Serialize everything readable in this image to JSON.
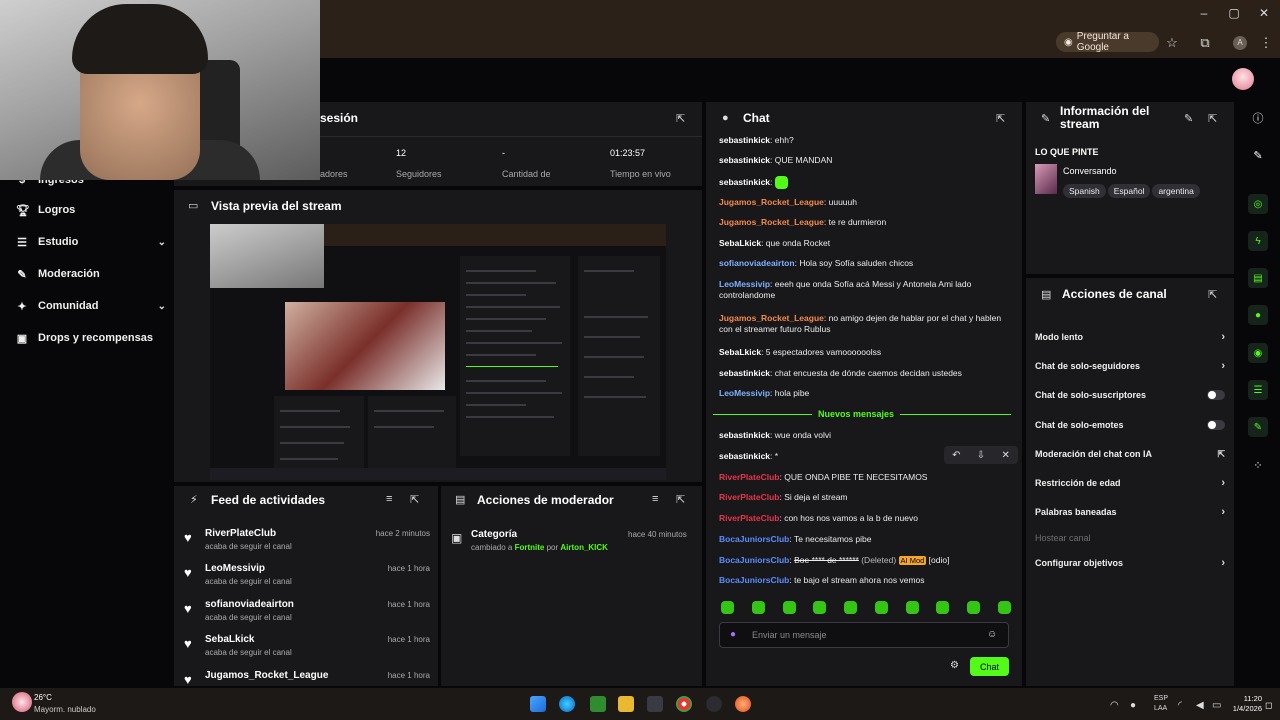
{
  "browser": {
    "ask_google": "Preguntar a Google",
    "profile_initial": "A"
  },
  "stats": {
    "section_title_partial": "sesión",
    "items": [
      {
        "value": "",
        "label": "adores"
      },
      {
        "value": "12",
        "label": "Seguidores"
      },
      {
        "value": "-",
        "label": "Cantidad de"
      },
      {
        "value": "01:23:57",
        "label": "Tiempo en vivo"
      }
    ]
  },
  "sidebar": {
    "partial_item": "Ingresos",
    "items": [
      {
        "label": "Logros",
        "icon": "trophy-icon",
        "chevron": false
      },
      {
        "label": "Estudio",
        "icon": "studio-icon",
        "chevron": true
      },
      {
        "label": "Moderación",
        "icon": "wrench-icon",
        "chevron": false
      },
      {
        "label": "Comunidad",
        "icon": "community-icon",
        "chevron": true
      },
      {
        "label": "Drops y recompensas",
        "icon": "gift-icon",
        "chevron": false
      }
    ]
  },
  "preview": {
    "title": "Vista previa del stream"
  },
  "feed": {
    "title": "Feed de actividades",
    "items": [
      {
        "name": "RiverPlateClub",
        "sub": "acaba de seguir el canal",
        "time": "hace 2 minutos"
      },
      {
        "name": "LeoMessivip",
        "sub": "acaba de seguir el canal",
        "time": "hace 1 hora"
      },
      {
        "name": "sofianoviadeairton",
        "sub": "acaba de seguir el canal",
        "time": "hace 1 hora"
      },
      {
        "name": "SebaLkick",
        "sub": "acaba de seguir el canal",
        "time": "hace 1 hora"
      },
      {
        "name": "Jugamos_Rocket_League",
        "sub": "",
        "time": "hace 1 hora"
      }
    ]
  },
  "modactions": {
    "title": "Acciones de moderador",
    "item": {
      "title": "Categoría",
      "pre": "cambiado a",
      "category": "Fortnite",
      "by": "por",
      "user": "Airton_KICK",
      "time": "hace 40 minutos"
    }
  },
  "chat": {
    "title": "Chat",
    "new_messages": "Nuevos mensajes",
    "input_placeholder": "Enviar un mensaje",
    "send_label": "Chat",
    "messages": [
      {
        "user": "sebastinkick",
        "color": "#ffffff",
        "text": "ehh?"
      },
      {
        "user": "sebastinkick",
        "color": "#ffffff",
        "text": "QUE MANDAN"
      },
      {
        "user": "sebastinkick",
        "color": "#ffffff",
        "text": ""
      },
      {
        "user": "Jugamos_Rocket_League",
        "color": "#f5894b",
        "text": "uuuuuh"
      },
      {
        "user": "Jugamos_Rocket_League",
        "color": "#f5894b",
        "text": "te re durmieron"
      },
      {
        "user": "SebaLkick",
        "color": "#ffffff",
        "text": "que onda Rocket"
      },
      {
        "user": "sofianoviadeairton",
        "color": "#7fb2ff",
        "text": "Hola soy Sofía saluden chicos"
      },
      {
        "user": "LeoMessivip",
        "color": "#7fb2ff",
        "text": "eeeh que onda Sofía acá Messi y Antonela Ami lado controlandome"
      },
      {
        "user": "Jugamos_Rocket_League",
        "color": "#f5894b",
        "text": "no amigo dejen de hablar por el chat y hablen con el streamer futuro Rublus"
      },
      {
        "user": "SebaLkick",
        "color": "#ffffff",
        "text": "5 espectadores vamoooooolss"
      },
      {
        "user": "sebastinkick",
        "color": "#ffffff",
        "text": "chat encuesta de dónde caemos decidan ustedes"
      },
      {
        "user": "LeoMessivip",
        "color": "#7fb2ff",
        "text": "hola pibe"
      },
      {
        "user": "sebastinkick",
        "color": "#ffffff",
        "text": "wue onda volvi"
      },
      {
        "user": "sebastinkick",
        "color": "#ffffff",
        "text": "*"
      },
      {
        "user": "RiverPlateClub",
        "color": "#e8344a",
        "text": "QUE ONDA PIBE TE NECESITAMOS"
      },
      {
        "user": "RiverPlateClub",
        "color": "#e8344a",
        "text": "Si deja el stream"
      },
      {
        "user": "RiverPlateClub",
        "color": "#e8344a",
        "text": "con hos nos vamos a la b de nuevo"
      },
      {
        "user": "BocaJuniorsClub",
        "color": "#5a8dff",
        "text": "Te necesitamos pibe"
      },
      {
        "user": "BocaJuniorsClub",
        "color": "#5a8dff",
        "text": "Boe **** de ******",
        "deleted": "(Deleted)",
        "badge": "AI Mod",
        "reason": "[odio]"
      },
      {
        "user": "BocaJuniorsClub",
        "color": "#5a8dff",
        "text": "te bajo el stream ahora nos vemos"
      }
    ]
  },
  "info": {
    "title": "Información del stream",
    "stream_title": "LO QUE PINTE",
    "category": "Conversando",
    "tags": [
      "Spanish",
      "Español",
      "argentina"
    ]
  },
  "channel_actions": {
    "title": "Acciones de canal",
    "items": [
      {
        "label": "Modo lento",
        "control": "chevron"
      },
      {
        "label": "Chat de solo-seguidores",
        "control": "chevron"
      },
      {
        "label": "Chat de solo-suscriptores",
        "control": "toggle"
      },
      {
        "label": "Chat de solo-emotes",
        "control": "toggle"
      },
      {
        "label": "Moderación del chat con IA",
        "control": "external"
      },
      {
        "label": "Restricción de edad",
        "control": "chevron"
      },
      {
        "label": "Palabras baneadas",
        "control": "chevron"
      },
      {
        "label": "Hostear canal",
        "control": "disabled"
      },
      {
        "label": "Configurar objetivos",
        "control": "chevron"
      }
    ]
  },
  "taskbar": {
    "temperature": "26°C",
    "weather": "Mayorm. nublado",
    "lang": "ESP",
    "lang2": "LAA",
    "time": "11:20",
    "date": "1/4/2026"
  }
}
